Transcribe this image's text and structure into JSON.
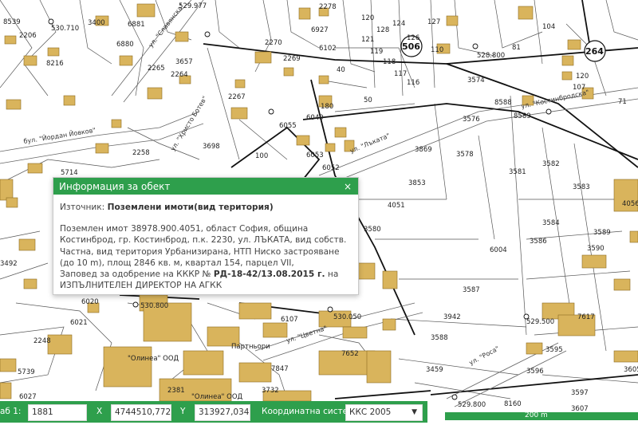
{
  "map": {
    "parcel_labels": [
      "8539",
      "2206",
      "8216",
      "3400",
      "6881",
      "6880",
      "2265",
      "2264",
      "3657",
      "2270",
      "2269",
      "6927",
      "6102",
      "2278",
      "120",
      "121",
      "119",
      "118",
      "117",
      "116",
      "128",
      "124",
      "127",
      "126",
      "110",
      "104",
      "81",
      "120",
      "107",
      "2267",
      "40",
      "50",
      "3574",
      "3576",
      "8588",
      "8589",
      "71",
      "6055",
      "6049",
      "6053",
      "6052",
      "180",
      "3698",
      "100",
      "3869",
      "3578",
      "3581",
      "3582",
      "3583",
      "2258",
      "3853",
      "4051",
      "3580",
      "6004",
      "3584",
      "3586",
      "3589",
      "3590",
      "3492",
      "6020",
      "6021",
      "2248",
      "5739",
      "6027",
      "2381",
      "7652",
      "3942",
      "3587",
      "3588",
      "3459",
      "8160",
      "3596",
      "3597",
      "3607",
      "7617",
      "3595",
      "3605",
      "5714",
      "4056",
      "6107",
      "7847",
      "3732"
    ],
    "street_labels": [
      "бул. \"Йордан Йовков\"",
      "ул. \"Славянска\"",
      "ул. \"Христо Ботев\"",
      "ул. \"Лъката\"",
      "ул. \"Костинбродска\"",
      "ул. \"Роса\"",
      "ул. \"Цветна\""
    ],
    "circle_labels": [
      "506",
      "264"
    ],
    "point_labels": [
      "530.710",
      "529.977",
      "530.800",
      "528.800",
      "530.050",
      "529.500",
      "529.800"
    ],
    "company_labels": [
      "\"Олинеа\" ООД",
      "Партньори",
      "\"Олинеа\" ООД"
    ]
  },
  "popup": {
    "title": "Информация за обект",
    "close": "×",
    "source_label": "Източник:",
    "source_value": "Поземлени имоти(вид територия)",
    "description": "Поземлен имот 38978.900.4051, област София, община Костинброд, гр. Костинброд, п.к. 2230, ул. ЛЪКАТА, вид собств. Частна, вид територия Урбанизирана, НТП Ниско застрояване (до 10 m), площ 2846 кв. м, квартал 154, парцел VII,",
    "order_prefix": "Заповед за одобрение на КККР №",
    "order_number": "РД-18-42/13.08.2015 г.",
    "order_suffix": "на ИЗПЪЛНИТЕЛЕН ДИРЕКТОР НА АГКК"
  },
  "bottom_bar": {
    "scale_label": "аб 1:",
    "scale_value": "1881",
    "x_label": "X",
    "x_value": "4744510,772",
    "y_label": "Y",
    "y_value": "313927,034",
    "crs_label": "Координатна система",
    "crs_value": "ККС 2005",
    "crs_arrow": "▼"
  },
  "scale_bar": {
    "label": "200 m"
  },
  "colors": {
    "accent": "#2e9f4c",
    "building": "#d9b45c",
    "building_stroke": "#8a6a20"
  }
}
